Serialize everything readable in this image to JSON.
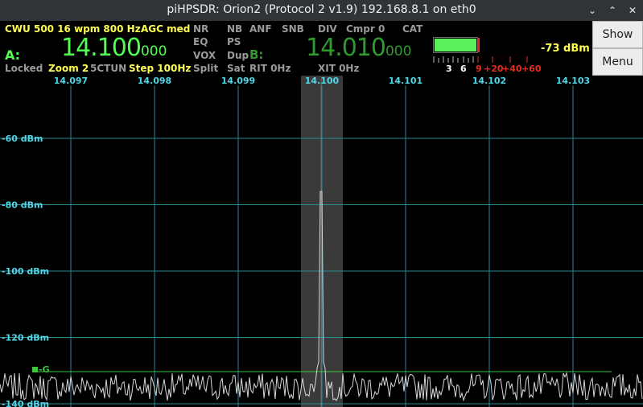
{
  "window": {
    "title": "piHPSDR: Orion2 (Protocol 2 v1.9) 192.168.8.1 on eth0",
    "minimize_glyph": "⌄",
    "maximize_glyph": "⌃",
    "close_glyph": "✕"
  },
  "vfo_bar": {
    "mode": "CWU 500 16 wpm 800 Hz",
    "agc": "AGC med",
    "vfo_a": {
      "label": "A:",
      "freq_main": "14.100",
      "freq_sub": "000"
    },
    "vfo_b": {
      "label": "B:",
      "freq_main": "14.010",
      "freq_sub": "000"
    },
    "locked": "Locked",
    "zoom": "Zoom 2",
    "ctun": "5CTUN",
    "step": "Step 100Hz",
    "flags": {
      "nr": "NR",
      "nb": "NB",
      "anf": "ANF",
      "snb": "SNB",
      "div": "DIV",
      "cmpr": "Cmpr 0",
      "cat": "CAT",
      "eq": "EQ",
      "ps": "PS",
      "vox": "VOX",
      "dup": "Dup",
      "split": "Split",
      "sat": "Sat",
      "rit": "RIT 0Hz",
      "xit": "XIT 0Hz"
    }
  },
  "meter": {
    "level": 0.38,
    "readout": "-73 dBm",
    "scale_white": [
      "3",
      "6"
    ],
    "scale_red": [
      "9",
      "+20",
      "+40",
      "+60"
    ]
  },
  "side_buttons": {
    "show": "Show",
    "menu": "Menu"
  },
  "panadapter": {
    "freq_ticks": [
      "14.097",
      "14.098",
      "14.099",
      "14.100",
      "14.101",
      "14.102",
      "14.103"
    ],
    "dbm_labels": [
      "-60 dBm",
      "-80 dBm",
      "-100 dBm",
      "-120 dBm",
      "-140 dBm"
    ],
    "agc_gain_label": "-G",
    "signal_peak_dbm": -76,
    "noise_floor_dbm": -139
  },
  "colors": {
    "grid": "#2a8a96",
    "axis_text": "#50d8e8",
    "trace": "#d8d8d8",
    "agc_line": "#3cc83c",
    "passband": "#3a3a3a",
    "meter_bar": "#5cf05c",
    "meter_peak": "#e03020"
  }
}
